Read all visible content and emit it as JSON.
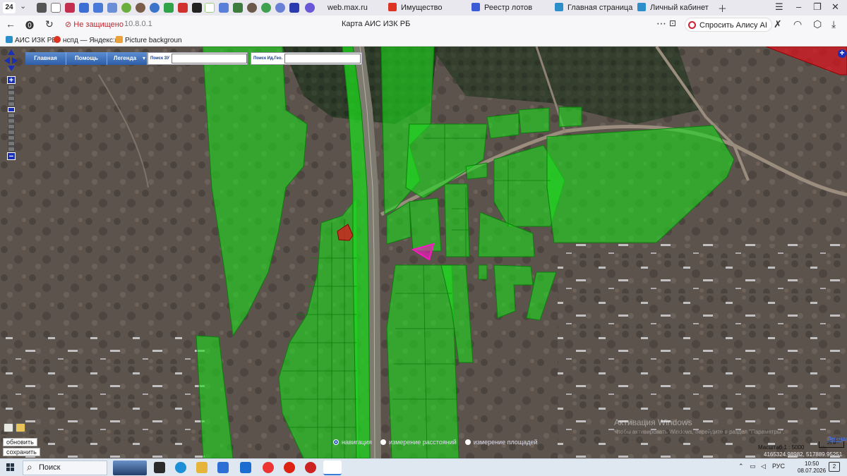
{
  "browser": {
    "tab_count": "24",
    "tabs": [
      {
        "label": "web.max.ru",
        "icon": "max-icon"
      },
      {
        "label": "Имущество",
        "icon": "rts-icon"
      },
      {
        "label": "Реестр лотов",
        "icon": "torgi-icon"
      },
      {
        "label": "Главная страница",
        "icon": "gosuslugi-icon"
      },
      {
        "label": "Личный кабинет",
        "icon": "gosuslugi-icon"
      }
    ],
    "insecure_label": "Не защищено",
    "url": "10.8.0.1",
    "page_title": "Карта АИС ИЗК РБ",
    "alice_button": "Спросить Алису AI",
    "bookmarks": [
      {
        "label": "АИС ИЗК РБ"
      },
      {
        "label": "нспд — Яндекс:н"
      },
      {
        "label": "Picture backgroun"
      }
    ]
  },
  "map": {
    "menu": {
      "home": "Главная",
      "help": "Помощь",
      "legend": "Легенда"
    },
    "search_zu_label": "Поиск ЗУ",
    "search_geo_label": "Поиск Ид.Гео.",
    "refresh_button": "обновить",
    "save_button": "сохранить",
    "modes": [
      {
        "label": "навигация",
        "selected": true
      },
      {
        "label": "измерение расстояний",
        "selected": false
      },
      {
        "label": "измерение площадей",
        "selected": false
      }
    ],
    "watermark_title": "Активация Windows",
    "watermark_sub": "Чтобы активировать Windows, перейдите в раздел \"Параметры\".",
    "legend_link": "Легенда",
    "scale_text": "Масштаб 1 : 5000",
    "scale_bar_label": "25 м",
    "coordinates": "4165324.98982, 517889.95251",
    "colors": {
      "parcel_green": "#1fd81f",
      "parcel_red": "#e0141e",
      "parcel_pink": "#ff14c8",
      "menu_blue": "#2d5ea8"
    }
  },
  "taskbar": {
    "search_placeholder": "Поиск",
    "language": "РУС",
    "time": "10:50",
    "date": "08.07.2026",
    "notification_count": "2"
  }
}
